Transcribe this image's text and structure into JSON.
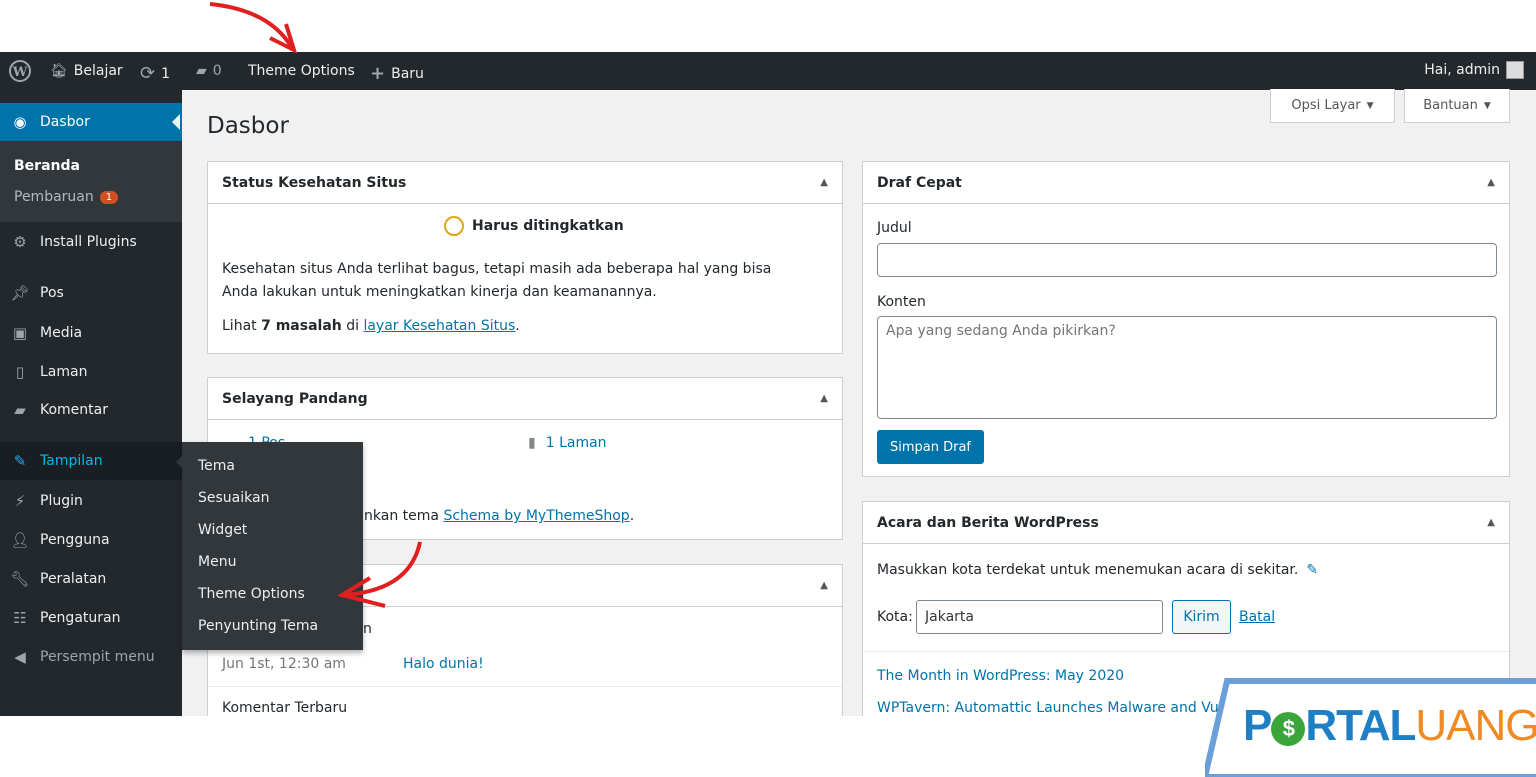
{
  "adminbar": {
    "site": "Belajar",
    "updates": "1",
    "comments": "0",
    "theme_options": "Theme Options",
    "new": "Baru",
    "greeting": "Hai, admin"
  },
  "sidebar": {
    "dashboard": "Dasbor",
    "home": "Beranda",
    "updates": "Pembaruan",
    "updates_count": "1",
    "items": [
      {
        "label": "Install Plugins",
        "icon": "gear-icon"
      },
      {
        "label": "Pos",
        "icon": "pin-icon"
      },
      {
        "label": "Media",
        "icon": "media-icon"
      },
      {
        "label": "Laman",
        "icon": "page-icon"
      },
      {
        "label": "Komentar",
        "icon": "comment-icon"
      },
      {
        "label": "Tampilan",
        "icon": "brush-icon"
      },
      {
        "label": "Plugin",
        "icon": "plugin-icon"
      },
      {
        "label": "Pengguna",
        "icon": "user-icon"
      },
      {
        "label": "Peralatan",
        "icon": "wrench-icon"
      },
      {
        "label": "Pengaturan",
        "icon": "settings-icon"
      },
      {
        "label": "Persempit menu",
        "icon": "collapse-icon"
      }
    ]
  },
  "flyout": [
    "Tema",
    "Sesuaikan",
    "Widget",
    "Menu",
    "Theme Options",
    "Penyunting Tema"
  ],
  "page": {
    "title": "Dasbor",
    "screen_options": "Opsi Layar",
    "help": "Bantuan"
  },
  "health": {
    "title": "Status Kesehatan Situs",
    "status": "Harus ditingkatkan",
    "desc": "Kesehatan situs Anda terlihat bagus, tetapi masih ada beberapa hal yang bisa Anda lakukan untuk meningkatkan kinerja dan keamanannya.",
    "see": "Lihat",
    "count": "7 masalah",
    "in": "di",
    "link": "layar Kesehatan Situs",
    "end": "."
  },
  "glance": {
    "title": "Selayang Pandang",
    "posts": "1 Pos",
    "pages": "1 Laman",
    "theme_pre": "alankan tema",
    "theme_link": "Schema by MyThemeShop",
    "end": "."
  },
  "activity": {
    "partial": "n",
    "date": "Jun 1st, 12:30 am",
    "post": "Halo dunia!",
    "recent_comments": "Komentar Terbaru"
  },
  "draft": {
    "title": "Draf Cepat",
    "title_label": "Judul",
    "title_value": "",
    "content_label": "Konten",
    "content_placeholder": "Apa yang sedang Anda pikirkan?",
    "save": "Simpan Draf"
  },
  "events": {
    "title": "Acara dan Berita WordPress",
    "prompt": "Masukkan kota terdekat untuk menemukan acara di sekitar.",
    "city_label": "Kota:",
    "city_value": "Jakarta",
    "submit": "Kirim",
    "cancel": "Batal",
    "news": [
      "The Month in WordPress: May 2020",
      "WPTavern: Automattic Launches Malware and Vulner"
    ]
  },
  "watermark": {
    "text_a": "P",
    "text_b": "RTAL",
    "text_c": "UANG",
    "colors": {
      "blue": "#1e7fc4",
      "orange": "#f08a24"
    }
  },
  "colors": {
    "accent": "#0073aa",
    "adminbar": "#23282d",
    "badge": "#d54e21",
    "annotation": "#e02020"
  }
}
